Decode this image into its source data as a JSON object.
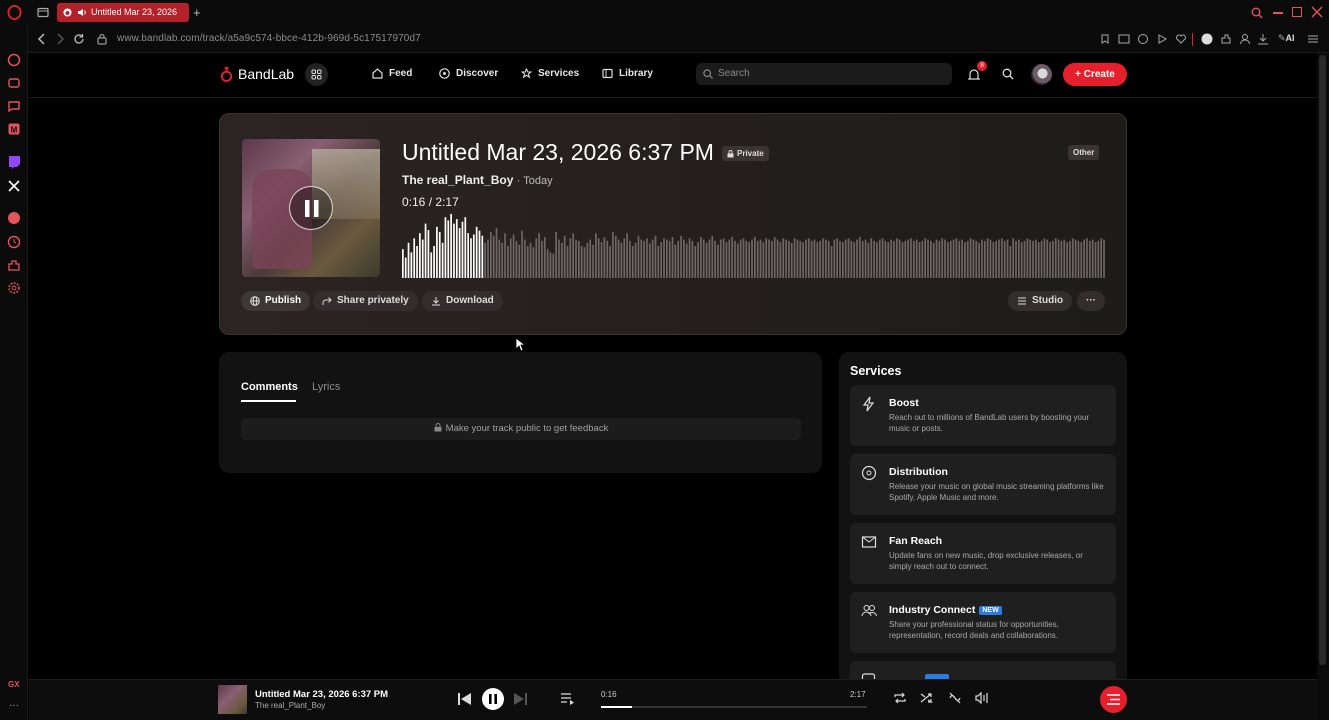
{
  "browser": {
    "tab_title": "Untitled Mar 23, 2026",
    "url": "www.bandlab.com/track/a5a9c574-bbce-412b-969d-5c17517970d7",
    "ai_label": "AI",
    "gx_label": "GX"
  },
  "nav": {
    "logo": "BandLab",
    "feed": "Feed",
    "discover": "Discover",
    "services": "Services",
    "library": "Library",
    "search_placeholder": "Search",
    "notification_count": "8",
    "create": "Create"
  },
  "track": {
    "title": "Untitled Mar 23, 2026 6:37 PM",
    "privacy": "Private",
    "artist": "The real_Plant_Boy",
    "when": "· Today",
    "current_time": "0:16",
    "separator": "/",
    "duration": "2:17",
    "genre": "Other",
    "progress": 0.117,
    "waveform": [
      0.45,
      0.32,
      0.55,
      0.4,
      0.62,
      0.5,
      0.7,
      0.6,
      0.85,
      0.75,
      0.4,
      0.5,
      0.8,
      0.72,
      0.55,
      0.95,
      0.9,
      1.0,
      0.85,
      0.92,
      0.78,
      0.88,
      0.95,
      0.7,
      0.62,
      0.68,
      0.8,
      0.74,
      0.66,
      0.55,
      0.6,
      0.72,
      0.66,
      0.78,
      0.6,
      0.55,
      0.7,
      0.5,
      0.62,
      0.68,
      0.58,
      0.52,
      0.74,
      0.6,
      0.5,
      0.55,
      0.48,
      0.62,
      0.7,
      0.58,
      0.64,
      0.45,
      0.4,
      0.38,
      0.72,
      0.6,
      0.55,
      0.66,
      0.5,
      0.62,
      0.7,
      0.6,
      0.58,
      0.5,
      0.48,
      0.55,
      0.6,
      0.52,
      0.7,
      0.62,
      0.56,
      0.64,
      0.58,
      0.5,
      0.72,
      0.66,
      0.6,
      0.55,
      0.62,
      0.7,
      0.58,
      0.5,
      0.55,
      0.66,
      0.6,
      0.58,
      0.62,
      0.54,
      0.6,
      0.66,
      0.5,
      0.56,
      0.62,
      0.6,
      0.58,
      0.64,
      0.52,
      0.58,
      0.66,
      0.6,
      0.54,
      0.62,
      0.58,
      0.5,
      0.56,
      0.64,
      0.6,
      0.55,
      0.6,
      0.66,
      0.58,
      0.52,
      0.6,
      0.62,
      0.56,
      0.6,
      0.64,
      0.58,
      0.54,
      0.6,
      0.62,
      0.58,
      0.56,
      0.6,
      0.64,
      0.58,
      0.6,
      0.56,
      0.62,
      0.6,
      0.58,
      0.64,
      0.6,
      0.56,
      0.62,
      0.6,
      0.58,
      0.55,
      0.62,
      0.6,
      0.58,
      0.56,
      0.6,
      0.62,
      0.58,
      0.6,
      0.56,
      0.58,
      0.62,
      0.6,
      0.58,
      0.5,
      0.6,
      0.62,
      0.58,
      0.56,
      0.6,
      0.62,
      0.58,
      0.56,
      0.6,
      0.64,
      0.58,
      0.6,
      0.55,
      0.62,
      0.58,
      0.56,
      0.6,
      0.62,
      0.58,
      0.56,
      0.6,
      0.58,
      0.62,
      0.6,
      0.56,
      0.58,
      0.6,
      0.62,
      0.58,
      0.6,
      0.56,
      0.58,
      0.62,
      0.6,
      0.58,
      0.55,
      0.6,
      0.58,
      0.62,
      0.6,
      0.56,
      0.58,
      0.6,
      0.62,
      0.58,
      0.6,
      0.56,
      0.58,
      0.62,
      0.6,
      0.58,
      0.55,
      0.6,
      0.58,
      0.62,
      0.6,
      0.56,
      0.58,
      0.6,
      0.62,
      0.58,
      0.6,
      0.5,
      0.62,
      0.58,
      0.6,
      0.56,
      0.58,
      0.62,
      0.6,
      0.58,
      0.6,
      0.56,
      0.58,
      0.62,
      0.6,
      0.56,
      0.58,
      0.62,
      0.6,
      0.58,
      0.6,
      0.56,
      0.58,
      0.62,
      0.6,
      0.58,
      0.56,
      0.6,
      0.62,
      0.58,
      0.6,
      0.56,
      0.58,
      0.62,
      0.6
    ]
  },
  "actions": {
    "publish": "Publish",
    "share": "Share privately",
    "download": "Download",
    "studio": "Studio",
    "more": "···"
  },
  "comments": {
    "tab_comments": "Comments",
    "tab_lyrics": "Lyrics",
    "notice": "Make your track public to get feedback"
  },
  "services": {
    "heading": "Services",
    "items": [
      {
        "title": "Boost",
        "desc": "Reach out to millions of BandLab users by boosting your music or posts.",
        "badge": ""
      },
      {
        "title": "Distribution",
        "desc": "Release your music on global music streaming platforms like Spotify, Apple Music and more.",
        "badge": ""
      },
      {
        "title": "Fan Reach",
        "desc": "Update fans on new music, drop exclusive releases, or simply reach out to connect.",
        "badge": ""
      },
      {
        "title": "Industry Connect",
        "desc": "Share your professional status for opportunities, representation, record deals and collaborations.",
        "badge": "NEW"
      }
    ]
  },
  "player": {
    "title": "Untitled Mar 23, 2026 6:37 PM",
    "artist": "The real_Plant_Boy",
    "current_time": "0:16",
    "duration": "2:17",
    "progress": 0.117
  },
  "colors": {
    "accent": "#e5202c",
    "badge_new": "#2b7de1",
    "bg": "#000000"
  }
}
